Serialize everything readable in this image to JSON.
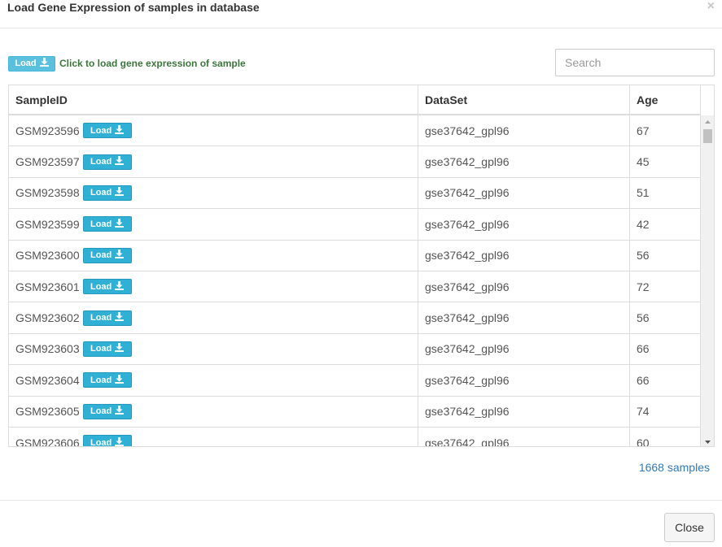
{
  "dialog": {
    "title": "Load Gene Expression of samples in database",
    "close_glyph": "×"
  },
  "hint": {
    "button_label": "Load",
    "button_icon": "download-icon",
    "text": "Click to load gene expression of sample"
  },
  "search": {
    "placeholder": "Search",
    "value": ""
  },
  "table": {
    "columns": [
      "SampleID",
      "DataSet",
      "Age"
    ],
    "load_label": "Load",
    "rows": [
      {
        "id": "GSM923596",
        "dataset": "gse37642_gpl96",
        "age": "67"
      },
      {
        "id": "GSM923597",
        "dataset": "gse37642_gpl96",
        "age": "45"
      },
      {
        "id": "GSM923598",
        "dataset": "gse37642_gpl96",
        "age": "51"
      },
      {
        "id": "GSM923599",
        "dataset": "gse37642_gpl96",
        "age": "42"
      },
      {
        "id": "GSM923600",
        "dataset": "gse37642_gpl96",
        "age": "56"
      },
      {
        "id": "GSM923601",
        "dataset": "gse37642_gpl96",
        "age": "72"
      },
      {
        "id": "GSM923602",
        "dataset": "gse37642_gpl96",
        "age": "56"
      },
      {
        "id": "GSM923603",
        "dataset": "gse37642_gpl96",
        "age": "66"
      },
      {
        "id": "GSM923604",
        "dataset": "gse37642_gpl96",
        "age": "66"
      },
      {
        "id": "GSM923605",
        "dataset": "gse37642_gpl96",
        "age": "74"
      },
      {
        "id": "GSM923606",
        "dataset": "gse37642_gpl96",
        "age": "60"
      }
    ]
  },
  "footer": {
    "sample_count": "1668 samples",
    "close_label": "Close"
  },
  "colors": {
    "info": "#5bc0de",
    "success_text": "#3c763d",
    "link": "#337ab7"
  }
}
